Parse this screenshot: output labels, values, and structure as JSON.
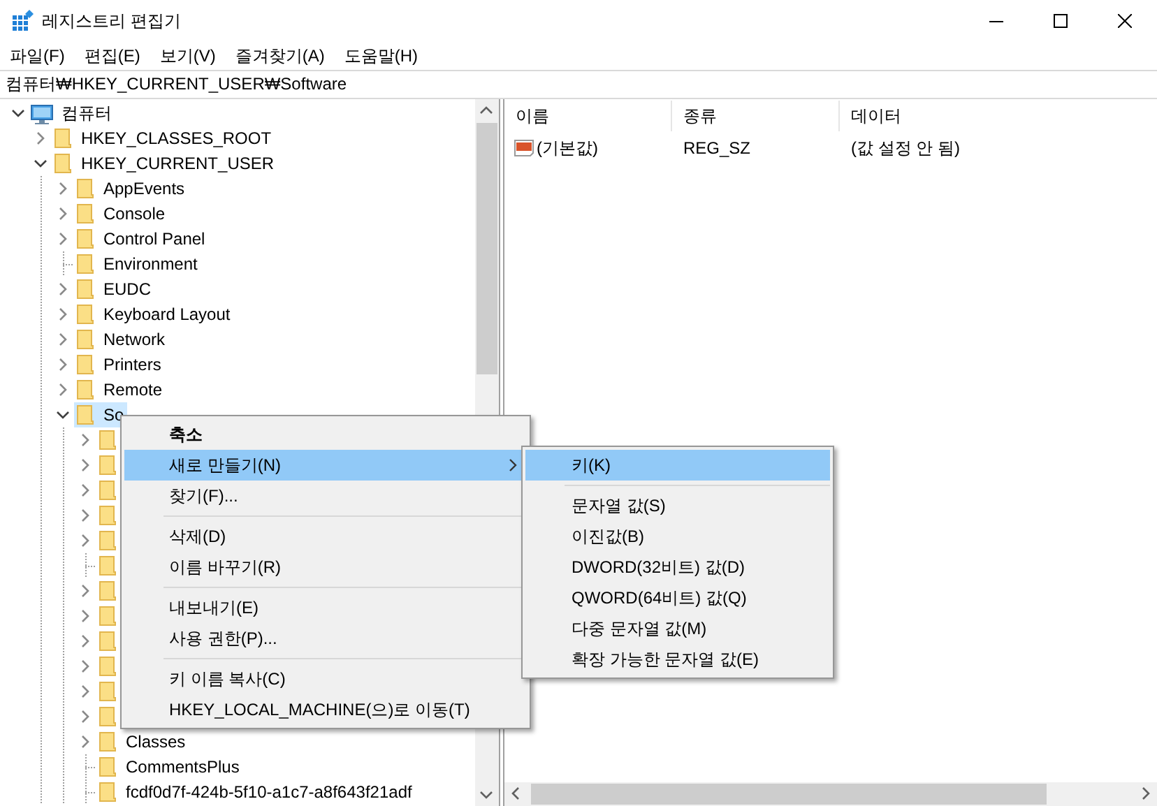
{
  "window": {
    "title": "레지스트리 편집기"
  },
  "menu_bar": [
    "파일(F)",
    "편집(E)",
    "보기(V)",
    "즐겨찾기(A)",
    "도움말(H)"
  ],
  "address": "컴퓨터₩HKEY_CURRENT_USER₩Software",
  "tree": {
    "label": "컴퓨터",
    "kind": "computer",
    "expandable": true,
    "expanded": true,
    "selected": false,
    "children": [
      {
        "label": "HKEY_CLASSES_ROOT",
        "kind": "folder",
        "expandable": true,
        "expanded": false,
        "selected": false
      },
      {
        "label": "HKEY_CURRENT_USER",
        "kind": "folder",
        "expandable": true,
        "expanded": true,
        "selected": false,
        "children": [
          {
            "label": "AppEvents",
            "kind": "folder",
            "expandable": true,
            "expanded": false,
            "selected": false
          },
          {
            "label": "Console",
            "kind": "folder",
            "expandable": true,
            "expanded": false,
            "selected": false
          },
          {
            "label": "Control Panel",
            "kind": "folder",
            "expandable": true,
            "expanded": false,
            "selected": false
          },
          {
            "label": "Environment",
            "kind": "folder",
            "expandable": false,
            "selected": false
          },
          {
            "label": "EUDC",
            "kind": "folder",
            "expandable": true,
            "expanded": false,
            "selected": false
          },
          {
            "label": "Keyboard Layout",
            "kind": "folder",
            "expandable": true,
            "expanded": false,
            "selected": false
          },
          {
            "label": "Network",
            "kind": "folder",
            "expandable": true,
            "expanded": false,
            "selected": false
          },
          {
            "label": "Printers",
            "kind": "folder",
            "expandable": true,
            "expanded": false,
            "selected": false
          },
          {
            "label": "Remote",
            "kind": "folder",
            "expandable": true,
            "expanded": false,
            "selected": false
          },
          {
            "label": "So",
            "kind": "folder",
            "expandable": true,
            "expanded": true,
            "selected": true,
            "children": [
              {
                "kind": "folder",
                "expandable": true,
                "expanded": false,
                "selected": false
              },
              {
                "kind": "folder",
                "expandable": true,
                "expanded": false,
                "selected": false
              },
              {
                "kind": "folder",
                "expandable": true,
                "expanded": false,
                "selected": false
              },
              {
                "kind": "folder",
                "expandable": true,
                "expanded": false,
                "selected": false
              },
              {
                "kind": "folder",
                "expandable": true,
                "expanded": false,
                "selected": false
              },
              {
                "kind": "folder",
                "expandable": false,
                "selected": false
              },
              {
                "kind": "folder",
                "expandable": true,
                "expanded": false,
                "selected": false
              },
              {
                "kind": "folder",
                "expandable": true,
                "expanded": false,
                "selected": false
              },
              {
                "kind": "folder",
                "expandable": true,
                "expanded": false,
                "selected": false
              },
              {
                "kind": "folder",
                "expandable": true,
                "expanded": false,
                "selected": false
              },
              {
                "kind": "folder",
                "expandable": true,
                "expanded": false,
                "selected": false
              },
              {
                "kind": "folder",
                "expandable": true,
                "expanded": false,
                "selected": false
              },
              {
                "label": "Classes",
                "kind": "folder",
                "expandable": true,
                "expanded": false,
                "selected": false
              },
              {
                "label": "CommentsPlus",
                "kind": "folder",
                "expandable": false,
                "selected": false
              },
              {
                "label": "fcdf0d7f-424b-5f10-a1c7-a8f643f21adf",
                "kind": "folder",
                "expandable": false,
                "selected": false
              }
            ]
          }
        ]
      }
    ]
  },
  "values": {
    "columns": [
      "이름",
      "종류",
      "데이터"
    ],
    "rows": [
      {
        "name": "(기본값)",
        "type": "REG_SZ",
        "data": "(값 설정 안 됨)"
      }
    ]
  },
  "context_menu": {
    "items": [
      {
        "kind": "item",
        "label": "축소",
        "default": true,
        "selected": false,
        "has_submenu": false
      },
      {
        "kind": "item",
        "label": "새로 만들기(N)",
        "default": false,
        "selected": true,
        "has_submenu": true
      },
      {
        "kind": "item",
        "label": "찾기(F)...",
        "default": false,
        "selected": false,
        "has_submenu": false
      },
      {
        "kind": "separator"
      },
      {
        "kind": "item",
        "label": "삭제(D)",
        "default": false,
        "selected": false,
        "has_submenu": false
      },
      {
        "kind": "item",
        "label": "이름 바꾸기(R)",
        "default": false,
        "selected": false,
        "has_submenu": false
      },
      {
        "kind": "separator"
      },
      {
        "kind": "item",
        "label": "내보내기(E)",
        "default": false,
        "selected": false,
        "has_submenu": false
      },
      {
        "kind": "item",
        "label": "사용 권한(P)...",
        "default": false,
        "selected": false,
        "has_submenu": false
      },
      {
        "kind": "separator"
      },
      {
        "kind": "item",
        "label": "키 이름 복사(C)",
        "default": false,
        "selected": false,
        "has_submenu": false
      },
      {
        "kind": "item",
        "label": "HKEY_LOCAL_MACHINE(으)로 이동(T)",
        "default": false,
        "selected": false,
        "has_submenu": false
      }
    ],
    "submenu": {
      "items": [
        {
          "kind": "item",
          "label": "키(K)",
          "selected": true
        },
        {
          "kind": "separator"
        },
        {
          "kind": "item",
          "label": "문자열 값(S)",
          "selected": false
        },
        {
          "kind": "item",
          "label": "이진값(B)",
          "selected": false
        },
        {
          "kind": "item",
          "label": "DWORD(32비트) 값(D)",
          "selected": false
        },
        {
          "kind": "item",
          "label": "QWORD(64비트) 값(Q)",
          "selected": false
        },
        {
          "kind": "item",
          "label": "다중 문자열 값(M)",
          "selected": false
        },
        {
          "kind": "item",
          "label": "확장 가능한 문자열 값(E)",
          "selected": false
        }
      ]
    }
  }
}
